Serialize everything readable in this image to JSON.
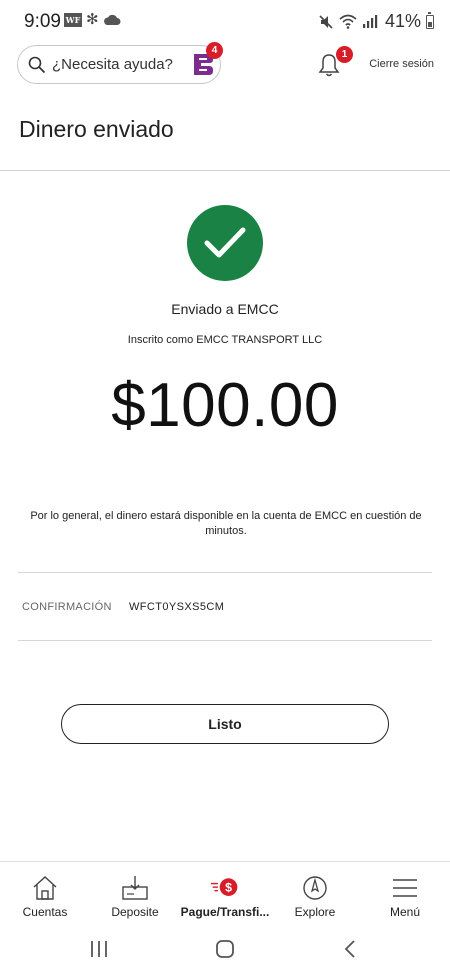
{
  "status_bar": {
    "time": "9:09",
    "wf_badge": "WF",
    "battery": "41%",
    "icons": [
      "wf-app-icon",
      "flower-icon",
      "cloud-icon",
      "mute-icon",
      "wifi-icon",
      "signal-icon",
      "battery-icon"
    ]
  },
  "header": {
    "search_placeholder": "¿Necesita ayuda?",
    "assistant_badge": "4",
    "notifications_badge": "1",
    "logout_label": "Cierre sesión"
  },
  "page": {
    "title": "Dinero enviado"
  },
  "confirmation": {
    "sent_to": "Enviado a EMCC",
    "enrolled_as": "Inscrito como EMCC TRANSPORT LLC",
    "amount": "$100.00",
    "availability_note": "Por lo general, el dinero estará disponible en la cuenta de EMCC en cuestión de minutos.",
    "confirmation_label": "CONFIRMACIÓN",
    "confirmation_code": "WFCT0YSXS5CM",
    "done_label": "Listo"
  },
  "bottom_nav": {
    "items": [
      {
        "label": "Cuentas",
        "icon": "home-icon"
      },
      {
        "label": "Deposite",
        "icon": "deposit-icon"
      },
      {
        "label": "Pague/Transfi...",
        "icon": "pay-transfer-icon"
      },
      {
        "label": "Explore",
        "icon": "compass-icon"
      },
      {
        "label": "Menú",
        "icon": "hamburger-icon"
      }
    ],
    "active_index": 2
  },
  "colors": {
    "success_green": "#1a8245",
    "brand_red": "#d71e28",
    "assistant_purple": "#7b2c8f"
  }
}
